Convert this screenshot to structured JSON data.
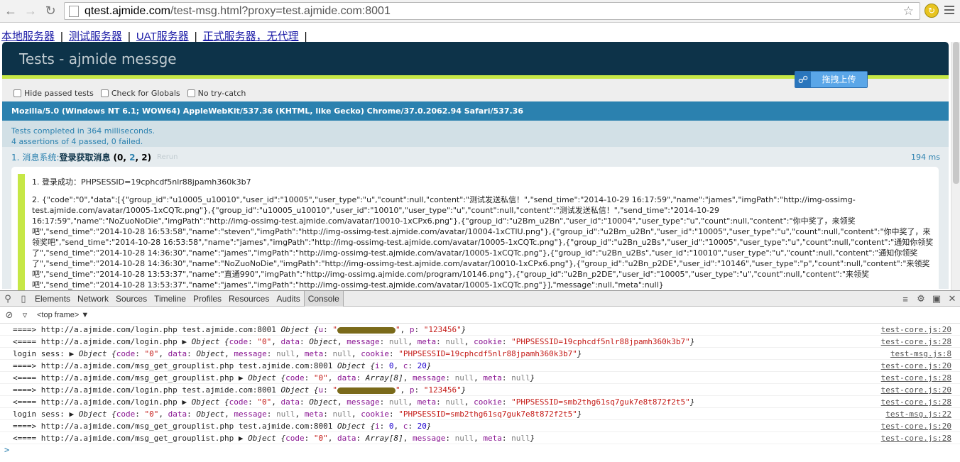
{
  "browser": {
    "url_host": "qtest.ajmide.com",
    "url_path": "/test-msg.html?proxy=test.ajmide.com:8001"
  },
  "server_links": [
    "本地服务器",
    "测试服务器",
    "UAT服务器",
    "正式服务器，无代理"
  ],
  "qunit": {
    "title": "Tests - ajmide messge",
    "toolbar": [
      "Hide passed tests",
      "Check for Globals",
      "No try-catch"
    ],
    "user_agent": "Mozilla/5.0 (Windows NT 6.1; WOW64) AppleWebKit/537.36 (KHTML, like Gecko) Chrome/37.0.2062.94 Safari/537.36",
    "result_line1": "Tests completed in 364 milliseconds.",
    "result_line2": "4 assertions of 4 passed, 0 failed.",
    "test": {
      "number": "1.",
      "module": "消息系统:",
      "name": "登录获取消息",
      "counts_open": "(0, ",
      "passed": "2",
      "counts_sep": ", ",
      "total": "2",
      "counts_close": ")",
      "rerun": "Rerun",
      "duration": "194 ms"
    },
    "assertions": [
      "1. 登录成功：PHPSESSID=19cphcdf5nlr88jpamh360k3b7",
      "2. {\"code\":\"0\",\"data\":[{\"group_id\":\"u10005_u10010\",\"user_id\":\"10005\",\"user_type\":\"u\",\"count\":null,\"content\":\"测试发送私信！\",\"send_time\":\"2014-10-29 16:17:59\",\"name\":\"james\",\"imgPath\":\"http://img-ossimg-test.ajmide.com/avatar/10005-1xCQTc.png\"},{\"group_id\":\"u10005_u10010\",\"user_id\":\"10010\",\"user_type\":\"u\",\"count\":null,\"content\":\"测试发送私信！\",\"send_time\":\"2014-10-29 16:17:59\",\"name\":\"NoZuoNoDie\",\"imgPath\":\"http://img-ossimg-test.ajmide.com/avatar/10010-1xCPx6.png\"},{\"group_id\":\"u2Bm_u2Bn\",\"user_id\":\"10004\",\"user_type\":\"u\",\"count\":null,\"content\":\"你中奖了，来领奖吧\",\"send_time\":\"2014-10-28 16:53:58\",\"name\":\"steven\",\"imgPath\":\"http://img-ossimg-test.ajmide.com/avatar/10004-1xCTlU.png\"},{\"group_id\":\"u2Bm_u2Bn\",\"user_id\":\"10005\",\"user_type\":\"u\",\"count\":null,\"content\":\"你中奖了，来领奖吧\",\"send_time\":\"2014-10-28 16:53:58\",\"name\":\"james\",\"imgPath\":\"http://img-ossimg-test.ajmide.com/avatar/10005-1xCQTc.png\"},{\"group_id\":\"u2Bn_u2Bs\",\"user_id\":\"10005\",\"user_type\":\"u\",\"count\":null,\"content\":\"通知你领奖了\",\"send_time\":\"2014-10-28 14:36:30\",\"name\":\"james\",\"imgPath\":\"http://img-ossimg-test.ajmide.com/avatar/10005-1xCQTc.png\"},{\"group_id\":\"u2Bn_u2Bs\",\"user_id\":\"10010\",\"user_type\":\"u\",\"count\":null,\"content\":\"通知你领奖了\",\"send_time\":\"2014-10-28 14:36:30\",\"name\":\"NoZuoNoDie\",\"imgPath\":\"http://img-ossimg-test.ajmide.com/avatar/10010-1xCPx6.png\"},{\"group_id\":\"u2Bn_p2DE\",\"user_id\":\"10146\",\"user_type\":\"p\",\"count\":null,\"content\":\"来领奖吧\",\"send_time\":\"2014-10-28 13:53:37\",\"name\":\"直通990\",\"imgPath\":\"http://img-ossimg.ajmide.com/program/10146.png\"},{\"group_id\":\"u2Bn_p2DE\",\"user_id\":\"10005\",\"user_type\":\"u\",\"count\":null,\"content\":\"来领奖吧\",\"send_time\":\"2014-10-28 13:53:37\",\"name\":\"james\",\"imgPath\":\"http://img-ossimg-test.ajmide.com/avatar/10005-1xCQTc.png\"}],\"message\":null,\"meta\":null}"
    ],
    "upload_button": "拖拽上传"
  },
  "devtools": {
    "tabs": [
      "Elements",
      "Network",
      "Sources",
      "Timeline",
      "Profiles",
      "Resources",
      "Audits",
      "Console"
    ],
    "active_tab": "Console",
    "frame": "<top frame>"
  },
  "console_rows": [
    {
      "prefix": "====> http://a.ajmide.com/login.php test.ajmide.com:8001 ",
      "kind": "login_req",
      "p": "\"123456\"",
      "src": "test-core.js:20"
    },
    {
      "prefix": "<==== http://a.ajmide.com/login.php ",
      "kind": "login_res",
      "cookie": "\"PHPSESSID=19cphcdf5nlr88jpamh360k3b7\"",
      "src": "test-core.js:28"
    },
    {
      "prefix": "login sess: ",
      "kind": "sess",
      "cookie": "\"PHPSESSID=19cphcdf5nlr88jpamh360k3b7\"",
      "src": "test-msg.js:8"
    },
    {
      "prefix": "====> http://a.ajmide.com/msg_get_grouplist.php test.ajmide.com:8001 ",
      "kind": "list_req",
      "src": "test-core.js:20"
    },
    {
      "prefix": "<==== http://a.ajmide.com/msg_get_grouplist.php ",
      "kind": "list_res",
      "src": "test-core.js:28"
    },
    {
      "prefix": "====> http://a.ajmide.com/login.php test.ajmide.com:8001 ",
      "kind": "login_req",
      "p": "\"123456\"",
      "src": "test-core.js:20"
    },
    {
      "prefix": "<==== http://a.ajmide.com/login.php ",
      "kind": "login_res",
      "cookie": "\"PHPSESSID=smb2thg61sq7guk7e8t872f2t5\"",
      "src": "test-core.js:28"
    },
    {
      "prefix": "login sess: ",
      "kind": "sess",
      "cookie": "\"PHPSESSID=smb2thg61sq7guk7e8t872f2t5\"",
      "src": "test-msg.js:22"
    },
    {
      "prefix": "====> http://a.ajmide.com/msg_get_grouplist.php test.ajmide.com:8001 ",
      "kind": "list_req",
      "src": "test-core.js:20"
    },
    {
      "prefix": "<==== http://a.ajmide.com/msg_get_grouplist.php ",
      "kind": "list_res",
      "src": "test-core.js:28"
    }
  ],
  "console_tokens": {
    "object": "Object",
    "code_val": "\"0\"",
    "data_obj": "Object",
    "data_arr": "Array[8]",
    "null": "null",
    "zero": "0",
    "twenty": "20"
  },
  "colors": {
    "qunit_header": "#0d3349",
    "qunit_banner": "#c6e746",
    "user_agent_bar": "#2b81af"
  }
}
